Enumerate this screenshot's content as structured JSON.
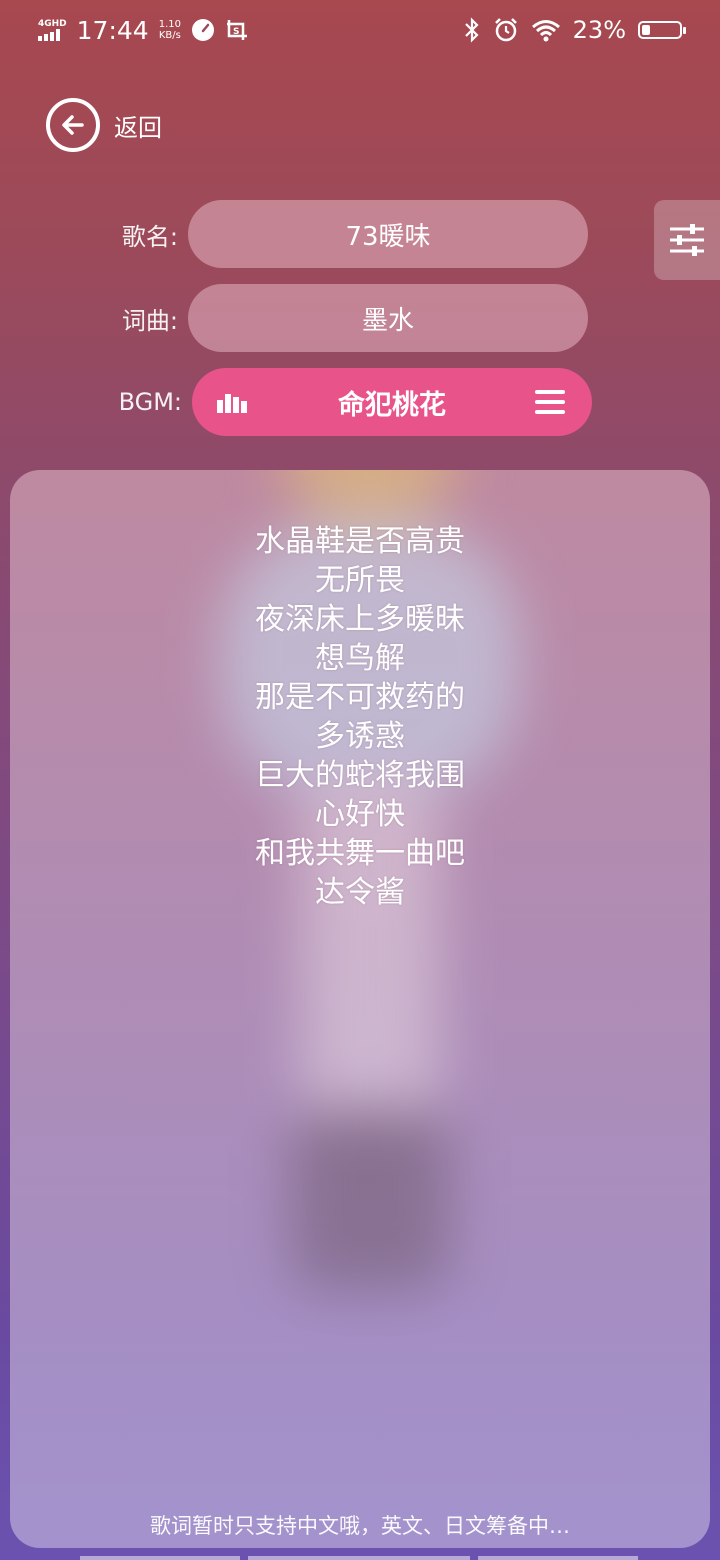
{
  "status_bar": {
    "network": "4GHD",
    "time": "17:44",
    "speed_value": "1.10",
    "speed_unit": "KB/s",
    "battery_percent": "23%",
    "battery_level": 0.23
  },
  "header": {
    "back_label": "返回"
  },
  "form": {
    "song_label": "歌名:",
    "song_value": "73暖味",
    "writer_label": "词曲:",
    "writer_value": "墨水",
    "bgm_label": "BGM:",
    "bgm_value": "命犯桃花"
  },
  "lyrics": [
    "水晶鞋是否高贵",
    "无所畏",
    "夜深床上多暖昧",
    "想鸟解",
    "那是不可救药的",
    "多诱惑",
    "巨大的蛇将我围",
    "心好快",
    "和我共舞一曲吧",
    "达令酱"
  ],
  "hint": "歌词暂时只支持中文哦，英文、日文筹备中…",
  "icons": {
    "back": "arrow-left-circle-icon",
    "settings": "sliders-icon",
    "bgm_left": "equalizer-icon",
    "bgm_right": "menu-icon"
  },
  "colors": {
    "bgm_pill": "#e8538a",
    "background_top": "#a8484f",
    "background_bottom": "#6b52b0"
  }
}
